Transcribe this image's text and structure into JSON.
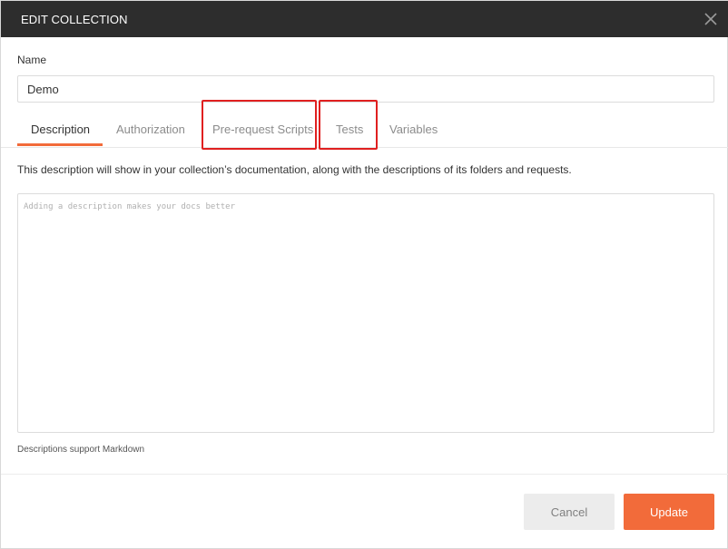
{
  "dialog": {
    "title": "EDIT COLLECTION",
    "close_icon": "close-icon"
  },
  "name_field": {
    "label": "Name",
    "value": "Demo"
  },
  "tabs": [
    {
      "label": "Description",
      "active": true
    },
    {
      "label": "Authorization",
      "active": false
    },
    {
      "label": "Pre-request Scripts",
      "active": false,
      "highlighted": true
    },
    {
      "label": "Tests",
      "active": false,
      "highlighted": true
    },
    {
      "label": "Variables",
      "active": false
    }
  ],
  "description": {
    "help_text": "This description will show in your collection’s documentation, along with the descriptions of its folders and requests.",
    "placeholder": "Adding a description makes your docs better",
    "value": "",
    "markdown_note": "Descriptions support Markdown"
  },
  "footer": {
    "cancel_label": "Cancel",
    "update_label": "Update"
  },
  "colors": {
    "titlebar": "#2d2d2d",
    "accent": "#f26b3a",
    "highlight_box": "#e02020"
  }
}
